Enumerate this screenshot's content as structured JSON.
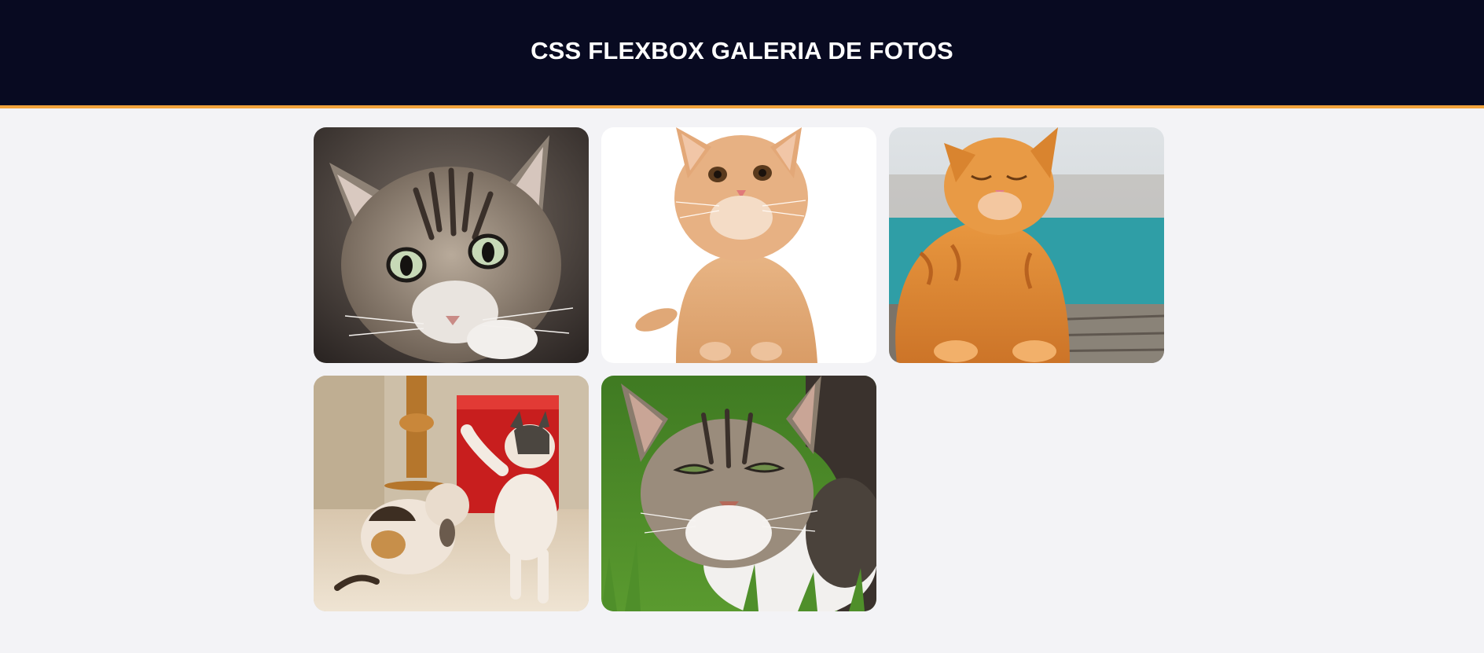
{
  "header": {
    "title": "CSS FLEXBOX GALERIA DE FOTOS"
  },
  "gallery": {
    "photos": [
      {
        "subject": "tabby cat close-up looking up",
        "icon": "tabby-cat-photo"
      },
      {
        "subject": "ginger kitten on white background",
        "icon": "ginger-kitten-photo"
      },
      {
        "subject": "orange cat sitting by the sea",
        "icon": "orange-cat-photo"
      },
      {
        "subject": "two calico kittens playing",
        "icon": "kittens-playing-photo"
      },
      {
        "subject": "tabby and white cat lying in grass",
        "icon": "cat-in-grass-photo"
      }
    ]
  },
  "colors": {
    "header_bg": "#080a21",
    "header_border": "#f2a33b",
    "page_bg": "#f3f3f6",
    "title_text": "#ffffff"
  }
}
